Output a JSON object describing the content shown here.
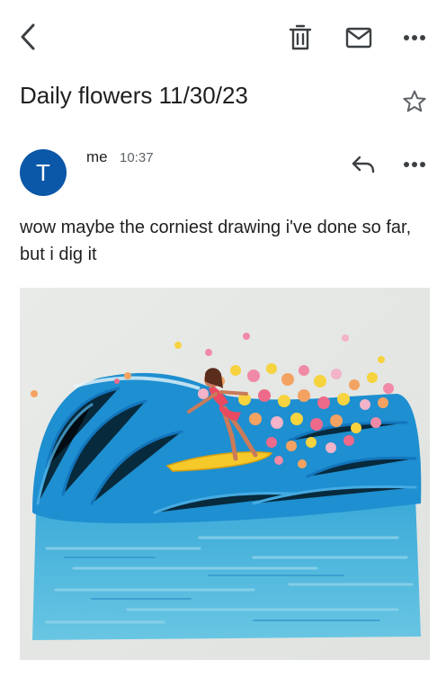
{
  "toolbar": {
    "back_icon": "chevron-left-icon",
    "delete_icon": "trash-icon",
    "mark_unread_icon": "mail-icon",
    "more_icon": "more-horizontal-icon"
  },
  "email": {
    "subject": "Daily flowers 11/30/23",
    "starred": false,
    "avatar_letter": "T",
    "avatar_color": "#0b57a8",
    "sender": "me",
    "time": "10:37",
    "body": "wow maybe the corniest drawing i've done so far, but i dig it"
  },
  "attachment": {
    "kind": "image",
    "subject": "crayon drawing of a surfer riding a blue wave with pink, orange and yellow flowers"
  }
}
